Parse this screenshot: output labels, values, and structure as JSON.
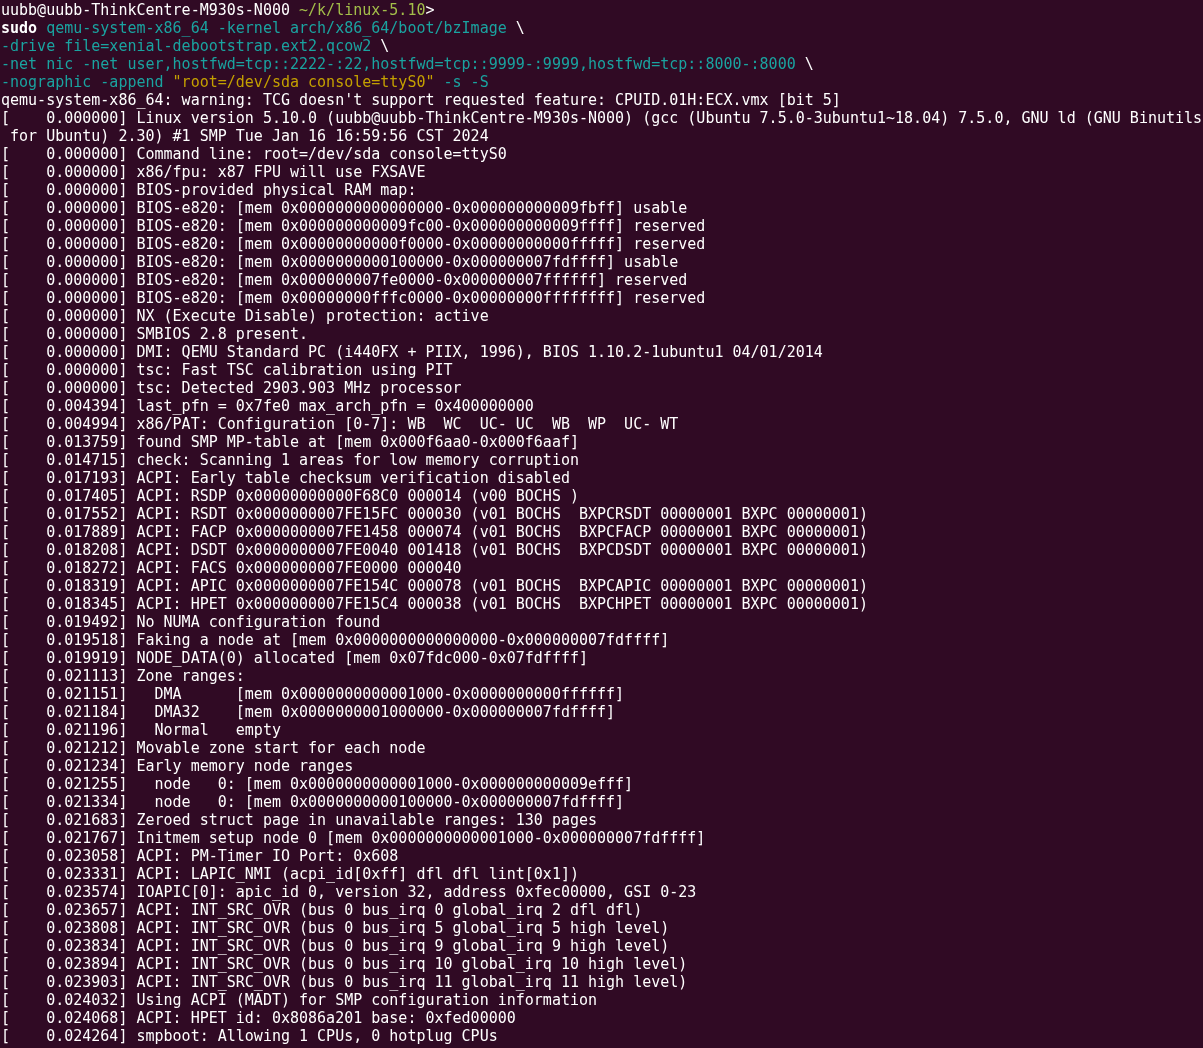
{
  "command_lines": [
    [
      {
        "kind": "user",
        "text": "uubb@uubb-ThinkCentre-M930s-N000"
      },
      {
        "kind": "path",
        "text": " ~/k/linux-5.10"
      },
      {
        "kind": "plain",
        "text": ">"
      }
    ],
    [
      {
        "kind": "keyword",
        "text": "sudo"
      },
      {
        "kind": "arg",
        "text": " qemu-system-x86_64 -kernel arch/x86_64/boot/bzImage "
      },
      {
        "kind": "plain",
        "text": "\\"
      }
    ],
    [
      {
        "kind": "arg",
        "text": "-drive file=xenial-debootstrap.ext2.qcow2 "
      },
      {
        "kind": "plain",
        "text": "\\"
      }
    ],
    [
      {
        "kind": "arg",
        "text": "-net nic -net user,hostfwd=tcp::2222-:22,hostfwd=tcp::9999-:9999,hostfwd=tcp::8000-:8000 "
      },
      {
        "kind": "plain",
        "text": "\\"
      }
    ],
    [
      {
        "kind": "arg",
        "text": "-nographic -append "
      },
      {
        "kind": "string",
        "text": "\"root=/dev/sda console=ttyS0\""
      },
      {
        "kind": "arg",
        "text": " -s -S"
      }
    ]
  ],
  "output_lines": [
    "qemu-system-x86_64: warning: TCG doesn't support requested feature: CPUID.01H:ECX.vmx [bit 5]",
    "[    0.000000] Linux version 5.10.0 (uubb@uubb-ThinkCentre-M930s-N000) (gcc (Ubuntu 7.5.0-3ubuntu1~18.04) 7.5.0, GNU ld (GNU Binutils",
    " for Ubuntu) 2.30) #1 SMP Tue Jan 16 16:59:56 CST 2024",
    "[    0.000000] Command line: root=/dev/sda console=ttyS0",
    "[    0.000000] x86/fpu: x87 FPU will use FXSAVE",
    "[    0.000000] BIOS-provided physical RAM map:",
    "[    0.000000] BIOS-e820: [mem 0x0000000000000000-0x000000000009fbff] usable",
    "[    0.000000] BIOS-e820: [mem 0x000000000009fc00-0x000000000009ffff] reserved",
    "[    0.000000] BIOS-e820: [mem 0x00000000000f0000-0x00000000000fffff] reserved",
    "[    0.000000] BIOS-e820: [mem 0x0000000000100000-0x000000007fdffff] usable",
    "[    0.000000] BIOS-e820: [mem 0x000000007fe0000-0x000000007ffffff] reserved",
    "[    0.000000] BIOS-e820: [mem 0x00000000fffc0000-0x00000000ffffffff] reserved",
    "[    0.000000] NX (Execute Disable) protection: active",
    "[    0.000000] SMBIOS 2.8 present.",
    "[    0.000000] DMI: QEMU Standard PC (i440FX + PIIX, 1996), BIOS 1.10.2-1ubuntu1 04/01/2014",
    "[    0.000000] tsc: Fast TSC calibration using PIT",
    "[    0.000000] tsc: Detected 2903.903 MHz processor",
    "[    0.004394] last_pfn = 0x7fe0 max_arch_pfn = 0x400000000",
    "[    0.004994] x86/PAT: Configuration [0-7]: WB  WC  UC- UC  WB  WP  UC- WT",
    "[    0.013759] found SMP MP-table at [mem 0x000f6aa0-0x000f6aaf]",
    "[    0.014715] check: Scanning 1 areas for low memory corruption",
    "[    0.017193] ACPI: Early table checksum verification disabled",
    "[    0.017405] ACPI: RSDP 0x00000000000F68C0 000014 (v00 BOCHS )",
    "[    0.017552] ACPI: RSDT 0x0000000007FE15FC 000030 (v01 BOCHS  BXPCRSDT 00000001 BXPC 00000001)",
    "[    0.017889] ACPI: FACP 0x0000000007FE1458 000074 (v01 BOCHS  BXPCFACP 00000001 BXPC 00000001)",
    "[    0.018208] ACPI: DSDT 0x0000000007FE0040 001418 (v01 BOCHS  BXPCDSDT 00000001 BXPC 00000001)",
    "[    0.018272] ACPI: FACS 0x0000000007FE0000 000040",
    "[    0.018319] ACPI: APIC 0x0000000007FE154C 000078 (v01 BOCHS  BXPCAPIC 00000001 BXPC 00000001)",
    "[    0.018345] ACPI: HPET 0x0000000007FE15C4 000038 (v01 BOCHS  BXPCHPET 00000001 BXPC 00000001)",
    "[    0.019492] No NUMA configuration found",
    "[    0.019518] Faking a node at [mem 0x0000000000000000-0x000000007fdffff]",
    "[    0.019919] NODE_DATA(0) allocated [mem 0x07fdc000-0x07fdffff]",
    "[    0.021113] Zone ranges:",
    "[    0.021151]   DMA      [mem 0x0000000000001000-0x0000000000ffffff]",
    "[    0.021184]   DMA32    [mem 0x0000000001000000-0x000000007fdffff]",
    "[    0.021196]   Normal   empty",
    "[    0.021212] Movable zone start for each node",
    "[    0.021234] Early memory node ranges",
    "[    0.021255]   node   0: [mem 0x0000000000001000-0x000000000009efff]",
    "[    0.021334]   node   0: [mem 0x0000000000100000-0x000000007fdffff]",
    "[    0.021683] Zeroed struct page in unavailable ranges: 130 pages",
    "[    0.021767] Initmem setup node 0 [mem 0x0000000000001000-0x000000007fdffff]",
    "[    0.023058] ACPI: PM-Timer IO Port: 0x608",
    "[    0.023331] ACPI: LAPIC_NMI (acpi_id[0xff] dfl dfl lint[0x1])",
    "[    0.023574] IOAPIC[0]: apic_id 0, version 32, address 0xfec00000, GSI 0-23",
    "[    0.023657] ACPI: INT_SRC_OVR (bus 0 bus_irq 0 global_irq 2 dfl dfl)",
    "[    0.023808] ACPI: INT_SRC_OVR (bus 0 bus_irq 5 global_irq 5 high level)",
    "[    0.023834] ACPI: INT_SRC_OVR (bus 0 bus_irq 9 global_irq 9 high level)",
    "[    0.023894] ACPI: INT_SRC_OVR (bus 0 bus_irq 10 global_irq 10 high level)",
    "[    0.023903] ACPI: INT_SRC_OVR (bus 0 bus_irq 11 global_irq 11 high level)",
    "[    0.024032] Using ACPI (MADT) for SMP configuration information",
    "[    0.024068] ACPI: HPET id: 0x8086a201 base: 0xfed00000",
    "[    0.024264] smpboot: Allowing 1 CPUs, 0 hotplug CPUs"
  ]
}
